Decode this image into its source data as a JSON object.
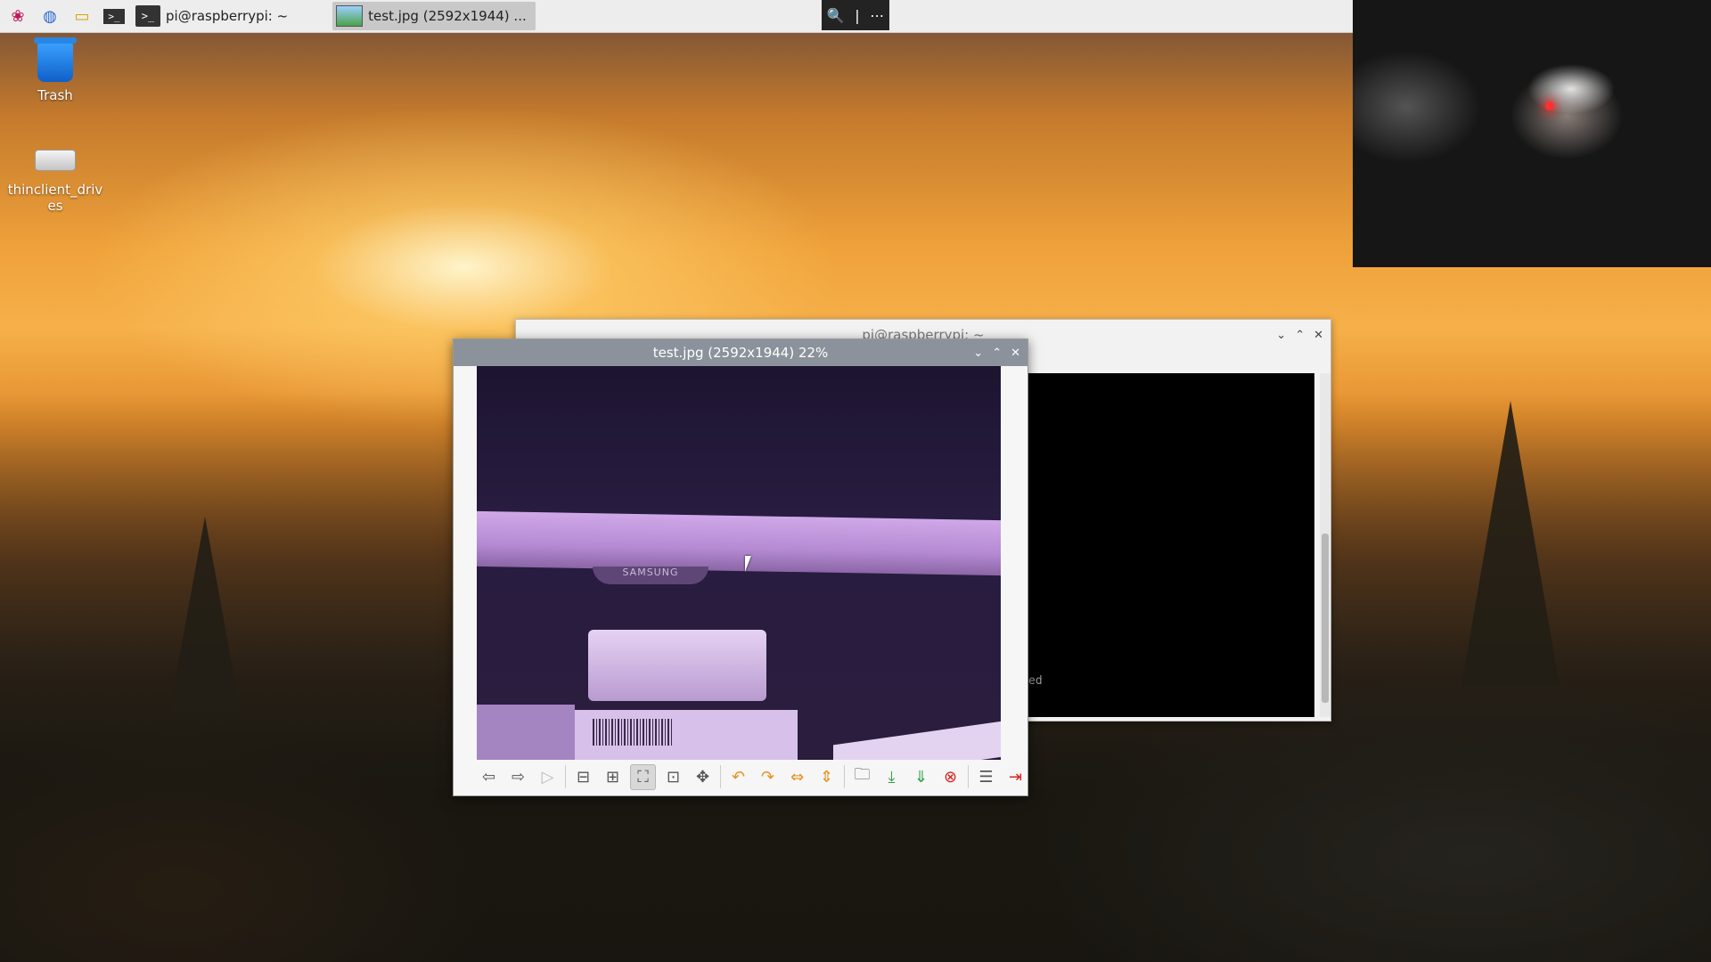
{
  "taskbar": {
    "menu_icon": "raspberry-pi-icon",
    "launchers": [
      "web-browser-icon",
      "file-manager-icon",
      "terminal-icon"
    ],
    "tasks": [
      {
        "label": "pi@raspberrypi: ~",
        "icon": "terminal-icon",
        "active": false
      },
      {
        "label": "test.jpg (2592x1944) ...",
        "icon": "image-viewer-icon",
        "active": true
      }
    ],
    "zoom_tools": {
      "zoom": "magnifier-icon",
      "separator": "|",
      "more": "⋯"
    }
  },
  "desktop": {
    "icons": [
      {
        "label": "Trash",
        "icon": "trash-icon"
      },
      {
        "label": "thinclient_drives",
        "icon": "drive-icon"
      }
    ]
  },
  "terminal_window": {
    "title": "pi@raspberrypi: ~",
    "visible_text": "ed",
    "buttons": {
      "minimize": "⌄",
      "maximize": "⌃",
      "close": "✕"
    }
  },
  "image_viewer": {
    "title": "test.jpg (2592x1944) 22%",
    "image_text": "SAMSUNG",
    "buttons": {
      "minimize": "⌄",
      "maximize": "⌃",
      "close": "✕"
    },
    "toolbar": [
      {
        "name": "previous-image-button",
        "glyph": "⇦"
      },
      {
        "name": "next-image-button",
        "glyph": "⇨"
      },
      {
        "name": "slideshow-button",
        "glyph": "▷"
      },
      {
        "name": "zoom-out-button",
        "glyph": "⊟"
      },
      {
        "name": "zoom-in-button",
        "glyph": "⊞"
      },
      {
        "name": "fit-window-button",
        "glyph": "⛶"
      },
      {
        "name": "original-size-button",
        "glyph": "⊡"
      },
      {
        "name": "fullscreen-button",
        "glyph": "✥"
      },
      {
        "name": "rotate-left-button",
        "glyph": "↶"
      },
      {
        "name": "rotate-right-button",
        "glyph": "↷"
      },
      {
        "name": "flip-horizontal-button",
        "glyph": "⇔"
      },
      {
        "name": "flip-vertical-button",
        "glyph": "⇕"
      },
      {
        "name": "open-file-button",
        "glyph": "🗀"
      },
      {
        "name": "save-file-button",
        "glyph": "⤓"
      },
      {
        "name": "save-as-button",
        "glyph": "⇓"
      },
      {
        "name": "delete-button",
        "glyph": "⊗"
      },
      {
        "name": "preferences-button",
        "glyph": "☰"
      },
      {
        "name": "quit-button",
        "glyph": "⇥"
      }
    ]
  },
  "colors": {
    "taskbar_bg": "#ededed",
    "viewer_title_bg": "#8b929b",
    "terminal_bg": "#000000"
  }
}
